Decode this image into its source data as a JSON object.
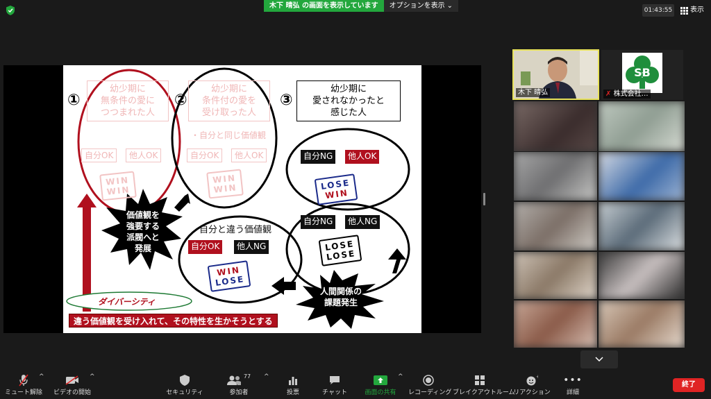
{
  "topbar": {
    "share_banner": "木下 晴弘 の画面を表示しています",
    "options_label": "オプションを表示",
    "clock": "01:43:55",
    "view_label": "表示"
  },
  "slide": {
    "num1": "①",
    "num2": "②",
    "num3": "③",
    "box1": [
      "幼少期に",
      "無条件の愛に",
      "つつまれた人"
    ],
    "box2": [
      "幼少期に",
      "条件付の愛を",
      "受け取った人"
    ],
    "box3": [
      "幼少期に",
      "愛されなかったと",
      "感じた人"
    ],
    "self_ok": "自分OK",
    "other_ok": "他人OK",
    "self_ng": "自分NG",
    "other_ng": "他人NG",
    "same_values": "・自分と同じ価値観",
    "diff_values": "自分と違う価値観",
    "win": "WIN",
    "lose": "LOSE",
    "burst1": [
      "価値観を",
      "強要する",
      "派閥へと",
      "発展"
    ],
    "burst2": [
      "人間関係の",
      "課題発生"
    ],
    "diversity": "ダイバーシティ",
    "bottom_banner": "違う価値観を受け入れて、その特性を生かそうとする"
  },
  "gallery": {
    "tile1_name": "木下 晴弘",
    "tile2_name": "株式会社…",
    "logo_text": "SB"
  },
  "toolbar": {
    "mute": "ミュート解除",
    "video": "ビデオの開始",
    "security": "セキュリティ",
    "participants": "参加者",
    "participant_count": "77",
    "polls": "投票",
    "chat": "チャット",
    "share": "画面の共有",
    "record": "レコーディング",
    "breakout": "ブレイクアウトルーム",
    "reactions": "リアクション",
    "more": "詳細",
    "end": "終了"
  },
  "colors": {
    "share_green": "#23a73d",
    "end_red": "#e02424",
    "slide_red": "#b0101e",
    "active_speaker": "#e8e25a"
  }
}
